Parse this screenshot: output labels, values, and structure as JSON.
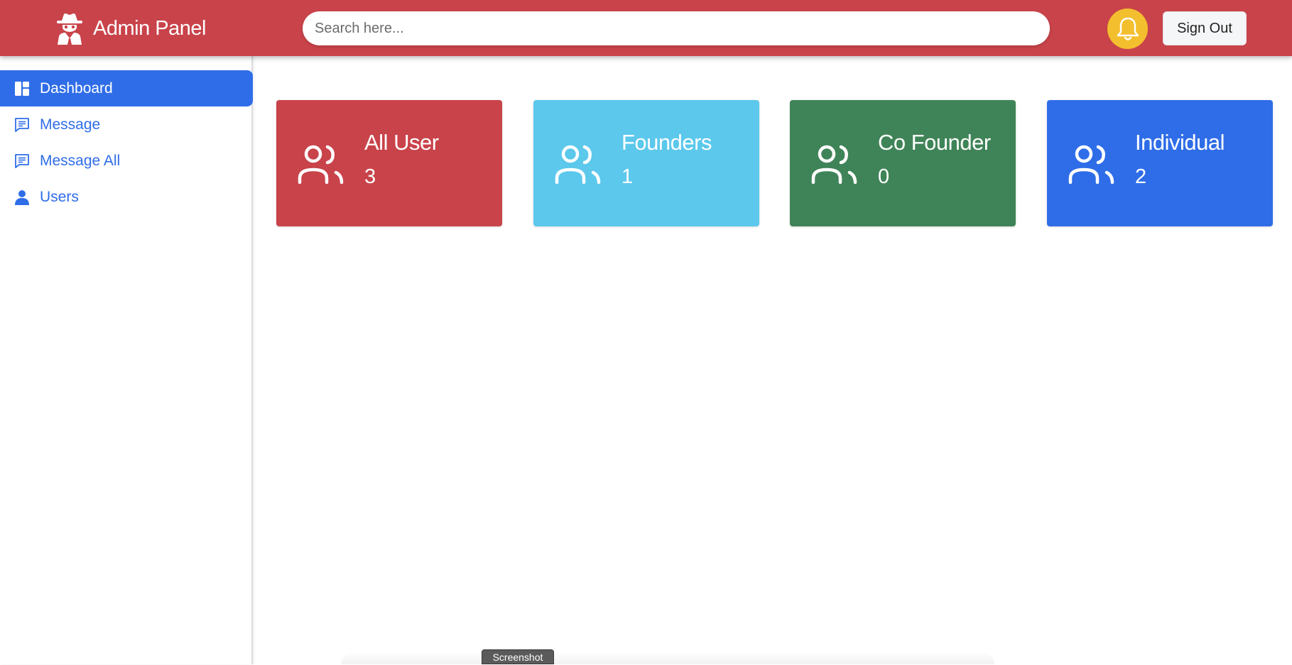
{
  "header": {
    "brand_title": "Admin Panel",
    "brand_icon": "spy-agent-icon",
    "search_placeholder": "Search here...",
    "notification_icon": "bell-icon",
    "signout_label": "Sign Out",
    "colors": {
      "header_bg": "#c9434a",
      "bell_bg": "#f4bf2e"
    }
  },
  "sidebar": {
    "items": [
      {
        "label": "Dashboard",
        "icon": "dashboard-icon",
        "active": true
      },
      {
        "label": "Message",
        "icon": "message-icon",
        "active": false
      },
      {
        "label": "Message All",
        "icon": "message-icon",
        "active": false
      },
      {
        "label": "Users",
        "icon": "user-icon",
        "active": false
      }
    ],
    "colors": {
      "accent": "#2f6de8"
    }
  },
  "cards": [
    {
      "label": "All User",
      "count": "3",
      "icon": "users-icon",
      "color": "#c9434a"
    },
    {
      "label": "Founders",
      "count": "1",
      "icon": "users-icon",
      "color": "#5bc8ec"
    },
    {
      "label": "Co Founder",
      "count": "0",
      "icon": "users-icon",
      "color": "#3f8458"
    },
    {
      "label": "Individual",
      "count": "2",
      "icon": "users-icon",
      "color": "#2f6de8"
    }
  ],
  "tooltip": {
    "label": "Screenshot"
  }
}
